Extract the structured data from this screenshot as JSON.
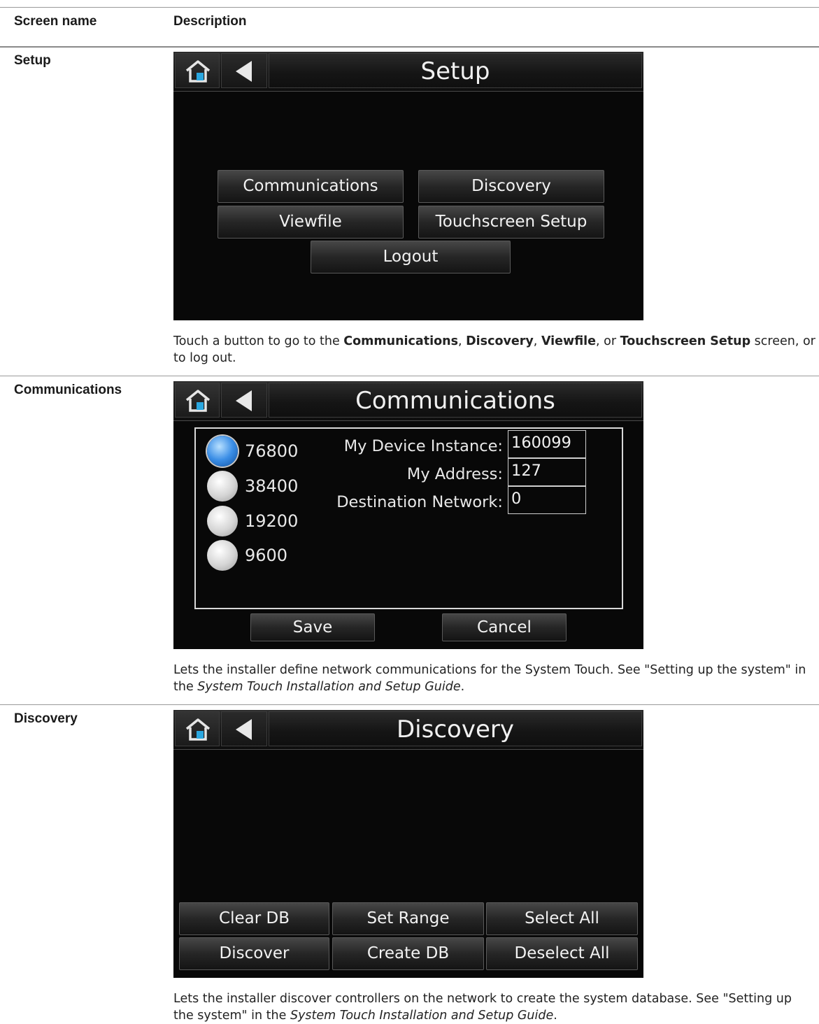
{
  "table": {
    "headers": {
      "screen_name": "Screen name",
      "description": "Description"
    },
    "rows": [
      {
        "name": "Setup",
        "screen": {
          "title": "Setup",
          "buttons": [
            "Communications",
            "Discovery",
            "Viewfile",
            "Touchscreen Setup",
            "Logout"
          ]
        },
        "desc": {
          "pre": "Touch a button to go to the ",
          "b1": "Communications",
          "c1": ", ",
          "b2": "Discovery",
          "c2": ", ",
          "b3": "Viewfile",
          "c3": ", or ",
          "b4": "Touchscreen Setup",
          "post": " screen, or to log out."
        }
      },
      {
        "name": "Communications",
        "screen": {
          "title": "Communications",
          "baud_rates": [
            "76800",
            "38400",
            "19200",
            "9600"
          ],
          "selected_baud": "76800",
          "fields": [
            {
              "label": "My Device Instance:",
              "value": "160099"
            },
            {
              "label": "My Address:",
              "value": "127"
            },
            {
              "label": "Destination Network:",
              "value": "0"
            }
          ],
          "save": "Save",
          "cancel": "Cancel"
        },
        "desc": {
          "pre": "Lets the installer define network communications for the System Touch. See \"Setting up the system\" in the ",
          "italic": "System Touch Installation and Setup Guide",
          "post": "."
        }
      },
      {
        "name": "Discovery",
        "screen": {
          "title": "Discovery",
          "buttons": [
            "Clear DB",
            "Set Range",
            "Select All",
            "Discover",
            "Create DB",
            "Deselect All"
          ]
        },
        "desc": {
          "pre": "Lets the installer discover controllers on the network to create the system database. See \"Setting up the system\" in the ",
          "italic": "System Touch Installation and Setup Guide",
          "post": "."
        }
      }
    ]
  },
  "colors": {
    "screen_bg": "#080808",
    "home_icon_accent": "#2aa7e0",
    "radio_selected": "#3b8ee6",
    "rule": "#9a9a9a"
  },
  "icons": {
    "home": "home-icon",
    "back": "back-arrow-icon",
    "radio": "radio-button"
  }
}
